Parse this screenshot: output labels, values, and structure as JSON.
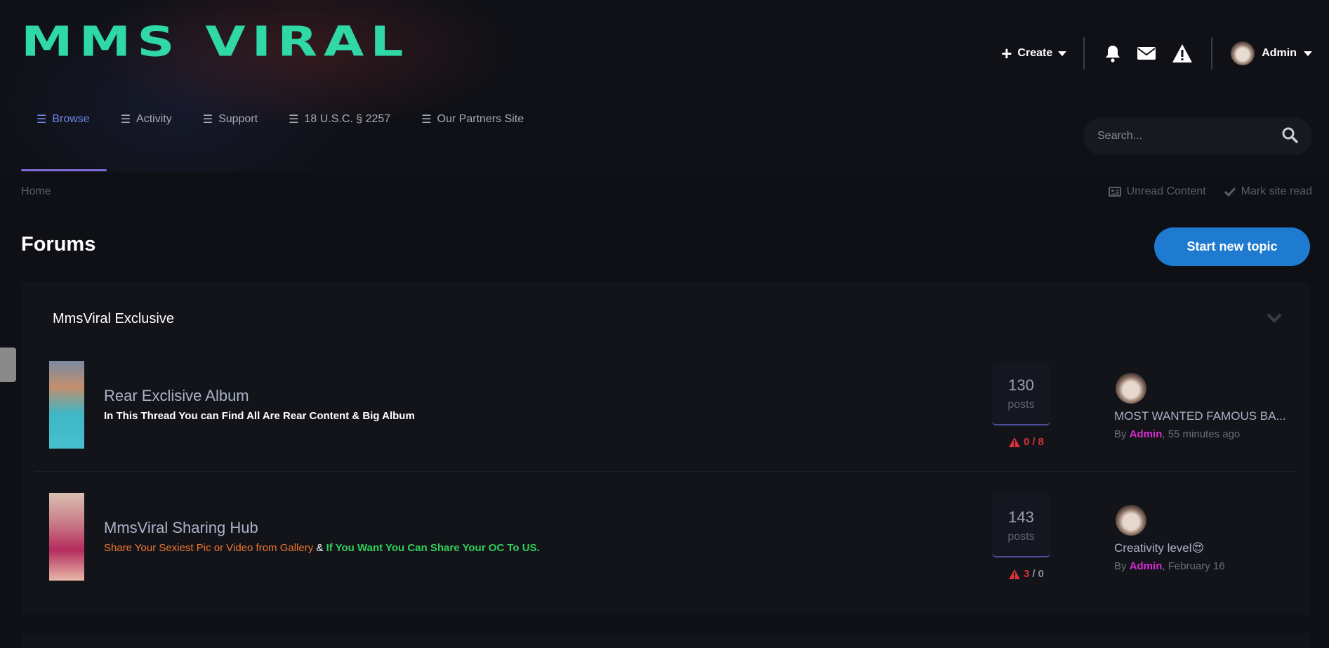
{
  "site": {
    "logo_text": "MMS VIRAL"
  },
  "user_bar": {
    "create_label": "Create",
    "user_name": "Admin",
    "icons": [
      "bell-icon",
      "envelope-icon",
      "warning-icon"
    ]
  },
  "nav": {
    "items": [
      {
        "label": "Browse",
        "active": true
      },
      {
        "label": "Activity"
      },
      {
        "label": "Support"
      },
      {
        "label": "18 U.S.C. § 2257"
      },
      {
        "label": "Our Partners Site"
      }
    ],
    "search_placeholder": "Search..."
  },
  "breadcrumb": {
    "home": "Home"
  },
  "actions": {
    "unread": "Unread Content",
    "mark_read": "Mark site read"
  },
  "page": {
    "title": "Forums",
    "start_topic": "Start new topic"
  },
  "category": {
    "title": "MmsViral Exclusive",
    "forums": [
      {
        "name": "Rear Exclisive Album",
        "description": "In This Thread You can Find All Are Rear Content & Big Album",
        "posts": "130",
        "posts_label": "posts",
        "reports_a": "0",
        "reports_sep": "/",
        "reports_b": "8",
        "last_title": "MOST WANTED FAMOUS BA...",
        "last_by": "By",
        "last_author": "Admin",
        "last_time": ", 55 minutes ago"
      },
      {
        "name": "MmsViral Sharing Hub",
        "desc_part1": "Share Your Sexiest Pic or Video from Gallery",
        "desc_part2": " & ",
        "desc_part3": "If You Want You Can Share Your OC To US.",
        "posts": "143",
        "posts_label": "posts",
        "reports_a": "3",
        "reports_sep": "/",
        "reports_b": "0",
        "last_title": "Creativity level😍",
        "last_by": "By",
        "last_author": "Admin",
        "last_time": ", February 16"
      }
    ]
  },
  "colors": {
    "logo": "#2fd8a4",
    "accent": "#6f86e8",
    "button": "#1e7bd0",
    "report_red": "#d9323a",
    "author": "#d82bd0",
    "desc_orange": "#f2762c",
    "desc_green": "#2fd059"
  }
}
